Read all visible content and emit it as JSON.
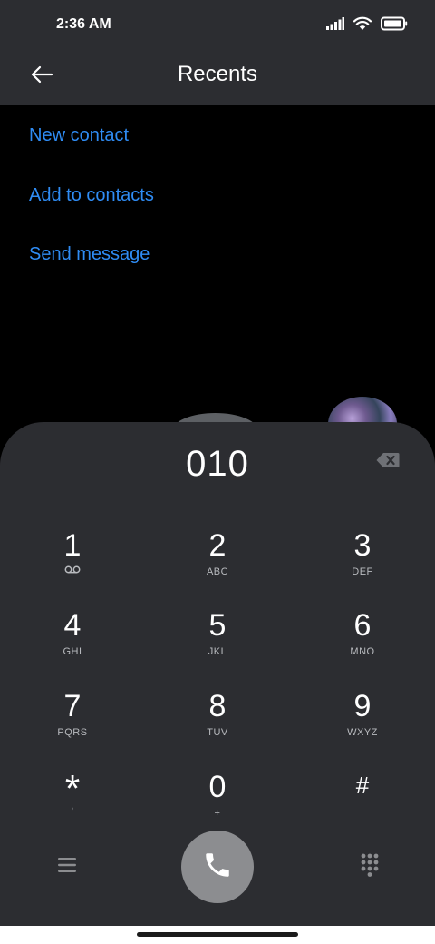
{
  "status_bar": {
    "time": "2:36 AM",
    "icons": [
      "signal-icon",
      "wifi-icon",
      "battery-icon"
    ]
  },
  "app_bar": {
    "back_icon": "arrow-left-icon",
    "title": "Recents"
  },
  "actions": {
    "new_contact": "New contact",
    "add_to_contacts": "Add to contacts",
    "send_message": "Send message"
  },
  "dialer": {
    "number": "010",
    "backspace_icon": "backspace-icon",
    "keys": [
      {
        "digit": "1",
        "letters": "",
        "icon": "voicemail-icon"
      },
      {
        "digit": "2",
        "letters": "ABC"
      },
      {
        "digit": "3",
        "letters": "DEF"
      },
      {
        "digit": "4",
        "letters": "GHI"
      },
      {
        "digit": "5",
        "letters": "JKL"
      },
      {
        "digit": "6",
        "letters": "MNO"
      },
      {
        "digit": "7",
        "letters": "PQRS"
      },
      {
        "digit": "8",
        "letters": "TUV"
      },
      {
        "digit": "9",
        "letters": "WXYZ"
      },
      {
        "digit": "*",
        "letters": ","
      },
      {
        "digit": "0",
        "letters": "+"
      },
      {
        "digit": "#",
        "letters": ""
      }
    ],
    "menu_icon": "menu-icon",
    "call_icon": "phone-icon",
    "keypad_icon": "dialpad-icon"
  },
  "colors": {
    "accent": "#2f8cf4",
    "surface": "#2c2d31",
    "background": "#000000",
    "call_button": "#8c8d90"
  }
}
